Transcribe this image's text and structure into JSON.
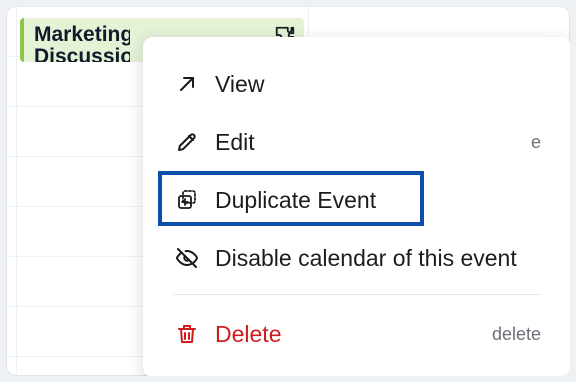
{
  "calendar": {
    "event": {
      "title": "Marketing Discussion"
    }
  },
  "context_menu": {
    "items": [
      {
        "label": "View",
        "shortcut": "",
        "icon": "arrow-up-right-icon"
      },
      {
        "label": "Edit",
        "shortcut": "e",
        "icon": "pencil-icon"
      },
      {
        "label": "Duplicate Event",
        "shortcut": "",
        "icon": "duplicate-icon"
      },
      {
        "label": "Disable calendar of this event",
        "shortcut": "",
        "icon": "eye-off-icon"
      },
      {
        "label": "Delete",
        "shortcut": "delete",
        "icon": "trash-icon"
      }
    ]
  },
  "colors": {
    "event_bg": "#e5f2d6",
    "event_accent": "#8ac64b",
    "highlight": "#0b4fa8",
    "danger": "#cf1d1d"
  }
}
